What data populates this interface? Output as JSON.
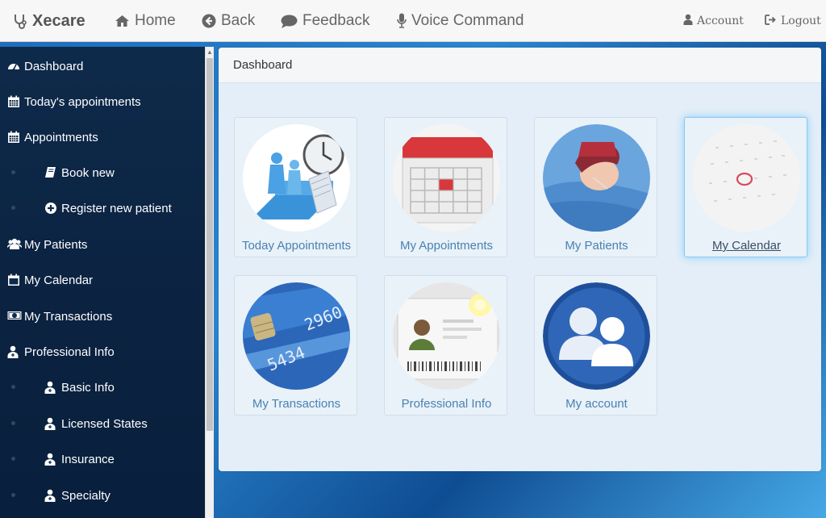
{
  "topbar": {
    "brand": "Xecare",
    "nav": [
      {
        "label": "Home",
        "icon": "home-icon"
      },
      {
        "label": "Back",
        "icon": "back-icon"
      },
      {
        "label": "Feedback",
        "icon": "comment-icon"
      },
      {
        "label": "Voice Command",
        "icon": "microphone-icon"
      }
    ],
    "account": "Account",
    "logout": "Logout"
  },
  "sidebar": {
    "items": [
      {
        "label": "Dashboard",
        "icon": "dashboard-icon",
        "level": 0
      },
      {
        "label": "Today's appointments",
        "icon": "calendar-icon",
        "level": 0
      },
      {
        "label": "Appointments",
        "icon": "calendar-icon",
        "level": 0
      },
      {
        "label": "Book new",
        "icon": "book-icon",
        "level": 1
      },
      {
        "label": "Register new patient",
        "icon": "plus-circle-icon",
        "level": 1
      },
      {
        "label": "My Patients",
        "icon": "users-icon",
        "level": 0
      },
      {
        "label": "My Calendar",
        "icon": "calendar-empty-icon",
        "level": 0
      },
      {
        "label": "My Transactions",
        "icon": "money-icon",
        "level": 0
      },
      {
        "label": "Professional Info",
        "icon": "user-md-icon",
        "level": 0
      },
      {
        "label": "Basic Info",
        "icon": "user-md-icon",
        "level": 1
      },
      {
        "label": "Licensed States",
        "icon": "user-md-icon",
        "level": 1
      },
      {
        "label": "Insurance",
        "icon": "user-md-icon",
        "level": 1
      },
      {
        "label": "Specialty",
        "icon": "user-md-icon",
        "level": 1
      }
    ]
  },
  "main": {
    "title": "Dashboard",
    "tiles": [
      {
        "label": "Today Appointments",
        "image": "clock-people-image"
      },
      {
        "label": "My Appointments",
        "image": "calendar-image"
      },
      {
        "label": "My Patients",
        "image": "sick-patient-image"
      },
      {
        "label": "My Calendar",
        "image": "calendar-circle-image",
        "active": true
      },
      {
        "label": "My Transactions",
        "image": "credit-card-image"
      },
      {
        "label": "Professional Info",
        "image": "id-card-image"
      },
      {
        "label": "My account",
        "image": "users-image"
      }
    ]
  },
  "colors": {
    "sidebar_bg": "#0e2a4a",
    "tile_label": "#4a82b0",
    "accent": "#2a85d0"
  }
}
